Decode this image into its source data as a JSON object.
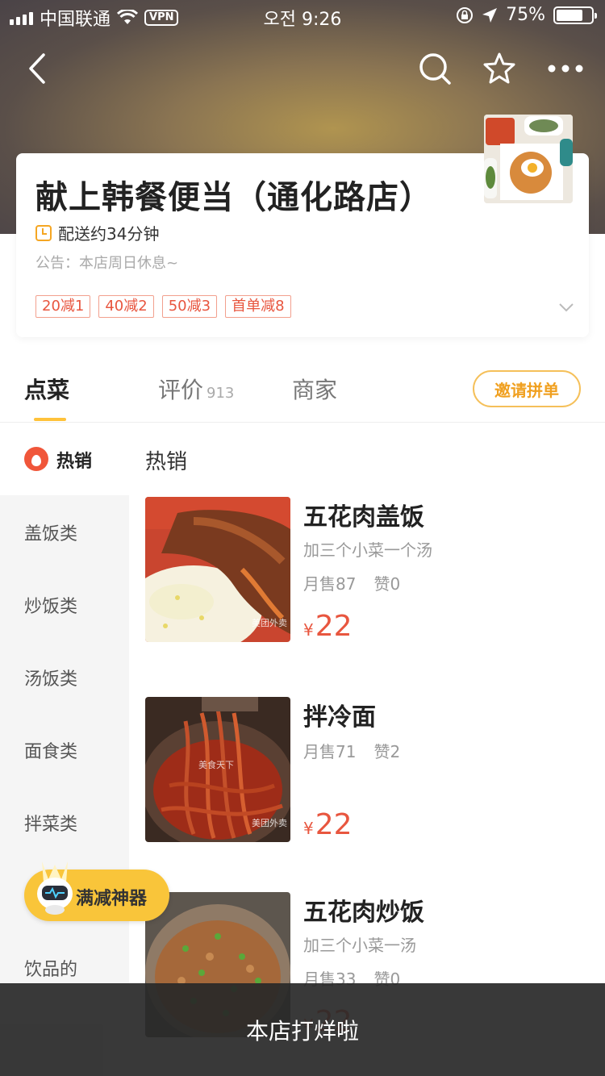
{
  "status_bar": {
    "carrier": "中国联通",
    "vpn": "VPN",
    "time": "오전 9:26",
    "battery": "75%",
    "battery_level": 0.75
  },
  "nav": {
    "back_icon": "chevron-left-icon",
    "search_icon": "search-icon",
    "favorite_icon": "star-icon",
    "more_icon": "more-icon"
  },
  "store": {
    "name": "献上韩餐便当（通化路店）",
    "delivery": "配送约34分钟",
    "notice": "公告：本店周日休息~",
    "promos": [
      "20减1",
      "40减2",
      "50减3",
      "首单减8"
    ]
  },
  "tabs": {
    "order": "点菜",
    "reviews": "评价",
    "reviews_count": "913",
    "merchant": "商家",
    "invite": "邀请拼单"
  },
  "sidebar": {
    "hot": "热销",
    "items": [
      "盖饭类",
      "炒饭类",
      "汤饭类",
      "面食类",
      "拌菜类",
      "饮品的"
    ]
  },
  "section_title": "热销",
  "foods": [
    {
      "name": "五花肉盖饭",
      "desc": "加三个小菜一个汤",
      "sales": "月售87",
      "likes": "赞0",
      "currency": "¥",
      "price": "22",
      "watermark": "美团外卖"
    },
    {
      "name": "拌冷面",
      "desc": "",
      "sales": "月售71",
      "likes": "赞2",
      "currency": "¥",
      "price": "22",
      "watermark": "美团外卖",
      "watermark2": "美食天下"
    },
    {
      "name": "五花肉炒饭",
      "desc": "加三个小菜一汤",
      "sales": "月售33",
      "likes": "赞0",
      "currency": "¥",
      "price": "22"
    }
  ],
  "badge": {
    "label": "满减神器"
  },
  "toast": "本店打烊啦",
  "colors": {
    "accent": "#ffc23a",
    "price": "#e8563f",
    "promo_border": "#f2a08e",
    "invite_border": "#f5c05a"
  }
}
